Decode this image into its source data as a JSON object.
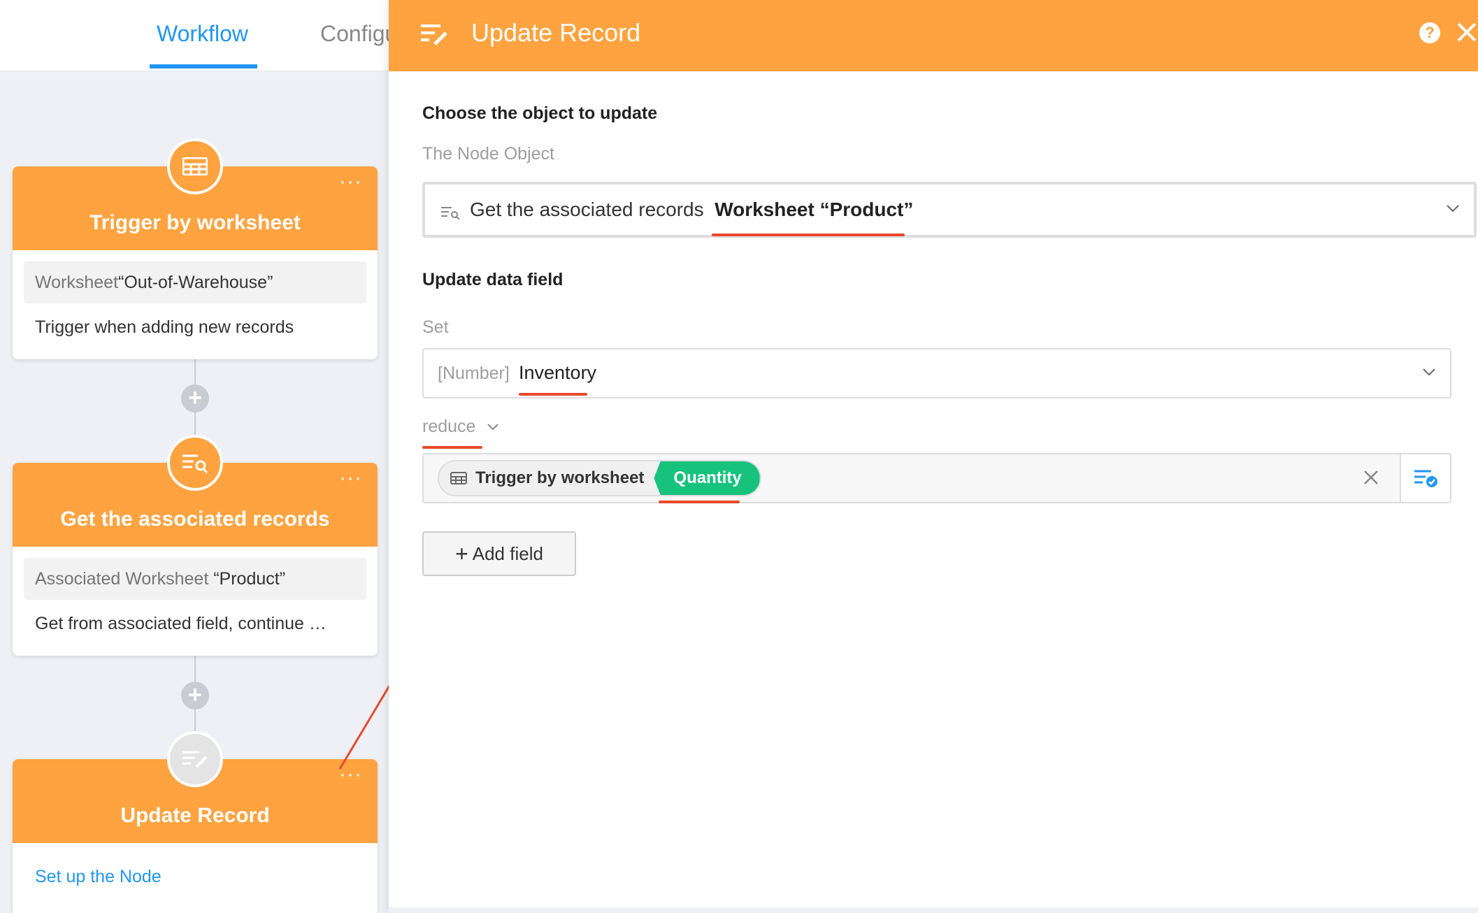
{
  "tabs": {
    "workflow": "Workflow",
    "config": "Configu"
  },
  "nodes": [
    {
      "title": "Trigger by worksheet",
      "info_label": "Worksheet",
      "info_value": "“Out-of-Warehouse”",
      "desc": "Trigger when adding new records",
      "icon": "table-icon"
    },
    {
      "title": "Get the associated records",
      "info_label": "Associated Worksheet",
      "info_value": "“Product”",
      "desc": "Get from associated field, continue …",
      "icon": "search-list-icon"
    },
    {
      "title": "Update Record",
      "desc": "Set up the Node",
      "icon": "edit-list-icon"
    }
  ],
  "panel": {
    "title": "Update Record",
    "help": "?",
    "choose_title": "Choose the object to update",
    "node_object_label": "The Node Object",
    "object_prefix": "Get the associated records",
    "object_value": "Worksheet “Product”",
    "update_title": "Update data field",
    "set_label": "Set",
    "field_type": "[Number]",
    "field_name": "Inventory",
    "operation": "reduce",
    "value_node": "Trigger by worksheet",
    "value_field": "Quantity",
    "add_field": "Add field",
    "add_plus": "+"
  },
  "colors": {
    "accent_orange": "#ffa340",
    "link_blue": "#2196f3",
    "field_green": "#16c27c",
    "annotation_red": "#e84a2c"
  }
}
